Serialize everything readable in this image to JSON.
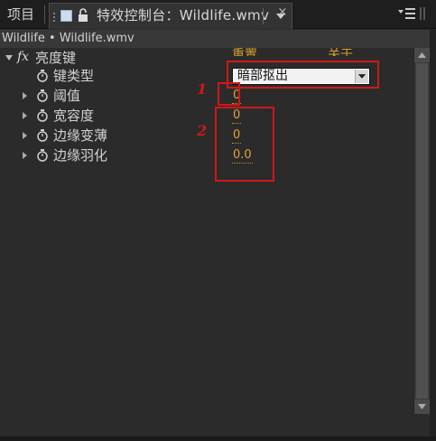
{
  "tabs": {
    "project_label": "项目",
    "active_title": "特效控制台：Wildlife.wmv",
    "close_glyph": "×"
  },
  "clip_header": "Wildlife • Wildlife.wmv",
  "effect": {
    "fx_badge": "fx",
    "name": "亮度键",
    "reset_label": "重置",
    "about_label": "关于",
    "properties": [
      {
        "label": "键类型",
        "value": "暗部抠出",
        "kind": "dropdown"
      },
      {
        "label": "阈值",
        "value": "0",
        "kind": "number"
      },
      {
        "label": "宽容度",
        "value": "0",
        "kind": "number"
      },
      {
        "label": "边缘变薄",
        "value": "0",
        "kind": "number"
      },
      {
        "label": "边缘羽化",
        "value": "0.0",
        "kind": "number"
      }
    ]
  },
  "annotations": {
    "marker_1": "1",
    "marker_2": "2"
  },
  "colors": {
    "accent_value": "#e2a13a",
    "annotation_red": "#d01818"
  },
  "icons": [
    "stopwatch-icon",
    "twisty-icon",
    "lock-icon",
    "panel-menu-icon",
    "close-icon",
    "chevron-down-icon"
  ]
}
